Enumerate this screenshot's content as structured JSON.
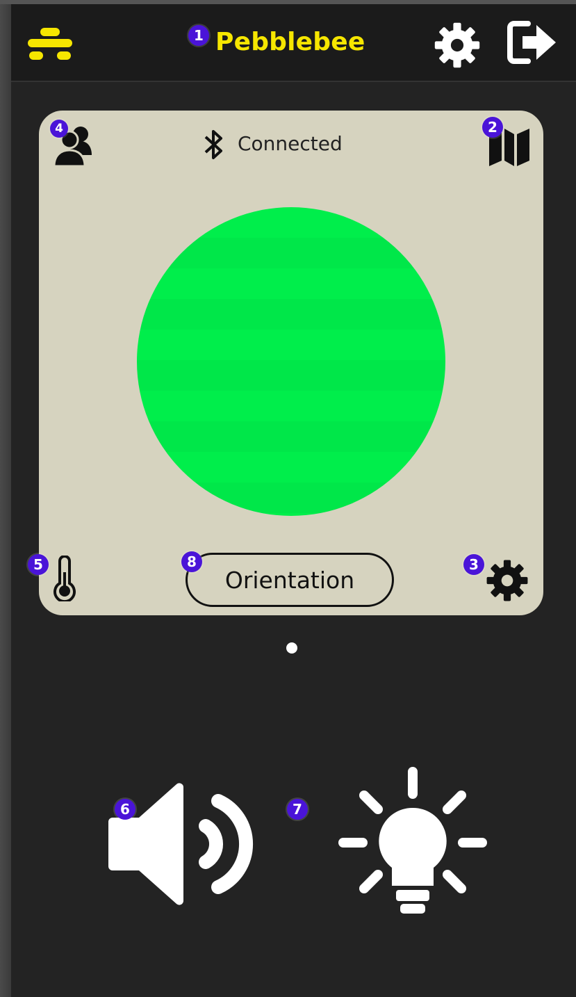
{
  "header": {
    "title": "Pebblebee",
    "title_color": "#f6e600",
    "logo_icon": "pebblebee-logo-icon",
    "settings_icon": "gear-icon",
    "logout_icon": "logout-icon"
  },
  "card": {
    "background": "#d6d3bf",
    "connection_status": "Connected",
    "bluetooth_icon": "bluetooth-icon",
    "share_icon": "users-icon",
    "map_icon": "map-icon",
    "status_color": "#00ee4b",
    "temperature_icon": "thermometer-icon",
    "orientation_button": "Orientation",
    "device_settings_icon": "gear-icon"
  },
  "pager": {
    "pages": 1,
    "current": 1
  },
  "actions": {
    "sound_icon": "speaker-icon",
    "light_icon": "lightbulb-icon"
  },
  "annotations": [
    "1",
    "2",
    "3",
    "4",
    "5",
    "6",
    "7",
    "8"
  ],
  "badge_color": "#4a14d8"
}
